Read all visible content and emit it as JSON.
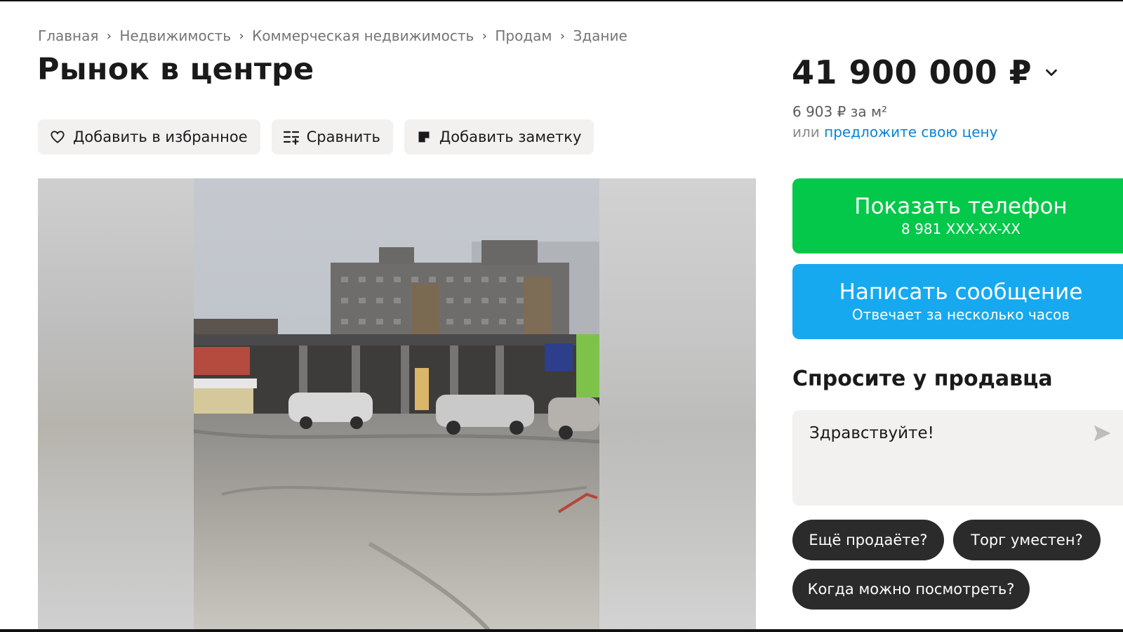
{
  "breadcrumb": [
    "Главная",
    "Недвижимость",
    "Коммерческая недвижимость",
    "Продам",
    "Здание"
  ],
  "title": "Рынок в центре",
  "actions": {
    "favorite": "Добавить в избранное",
    "compare": "Сравнить",
    "note": "Добавить заметку"
  },
  "price": {
    "value": "41 900 000 ₽",
    "per_sqm": "6 903 ₽ за м²",
    "offer_prefix": "или ",
    "offer_link": "предложите свою цену"
  },
  "contact": {
    "phone_label": "Показать телефон",
    "phone_masked": "8 981 XXX-XX-XX",
    "message_label": "Написать сообщение",
    "message_sub": "Отвечает за несколько часов"
  },
  "ask": {
    "title": "Спросите у продавца",
    "message": "Здравствуйте!",
    "quick_replies": [
      "Ещё продаёте?",
      "Торг уместен?",
      "Когда можно посмотреть?"
    ]
  },
  "colors": {
    "phone_button": "#04c84a",
    "message_button": "#16a9f0",
    "link": "#0a84d6",
    "chip": "#2b2b2b"
  },
  "icons": {
    "favorite": "heart-icon",
    "compare": "compare-icon",
    "note": "note-icon",
    "price_toggle": "chevron-down-icon",
    "send": "send-icon"
  }
}
